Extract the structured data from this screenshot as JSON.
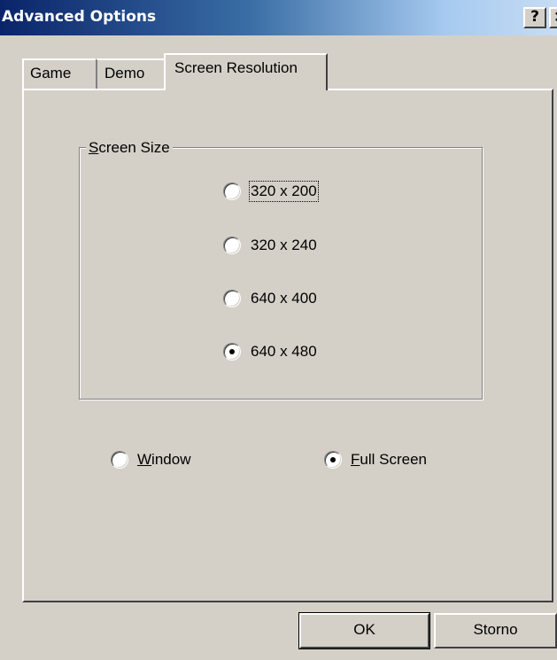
{
  "window": {
    "title": "Advanced Options",
    "help_button": "?",
    "close_button": "×"
  },
  "tabs": [
    {
      "label": "Game",
      "selected": false
    },
    {
      "label": "Demo",
      "selected": false
    },
    {
      "label": "Screen Resolution",
      "selected": true
    }
  ],
  "screen_size": {
    "group_label_accel": "S",
    "group_label_rest": "creen Size",
    "options": [
      {
        "label": "320 x 200",
        "checked": false,
        "focused": true
      },
      {
        "label": "320 x 240",
        "checked": false,
        "focused": false
      },
      {
        "label": "640 x 400",
        "checked": false,
        "focused": false
      },
      {
        "label": "640 x 480",
        "checked": true,
        "focused": false
      }
    ]
  },
  "display_mode": {
    "window_accel": "W",
    "window_rest": "indow",
    "window_checked": false,
    "fullscreen_accel": "F",
    "fullscreen_rest": "ull Screen",
    "fullscreen_checked": true
  },
  "buttons": {
    "ok": "OK",
    "storno": "Storno"
  }
}
